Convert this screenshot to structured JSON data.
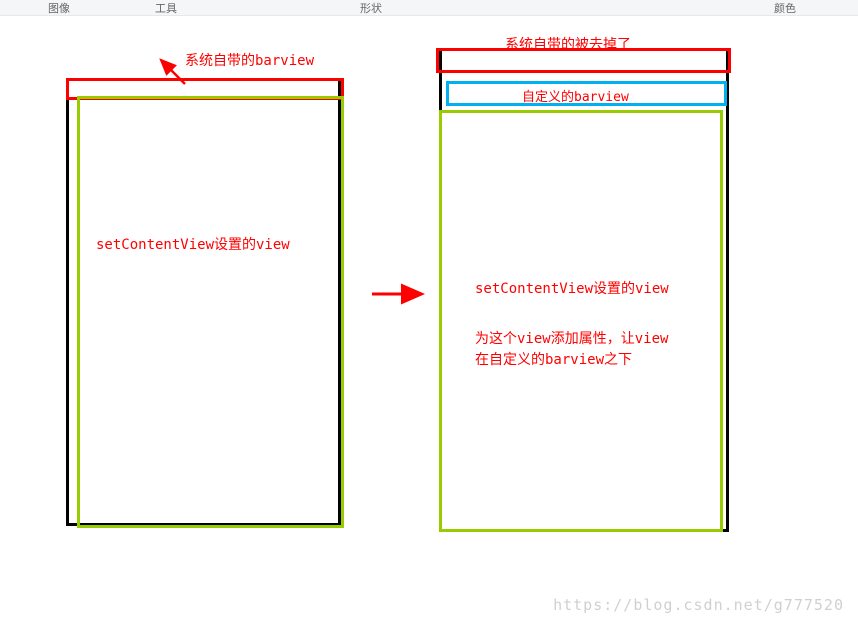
{
  "toolbar": {
    "image": "图像",
    "tool": "工具",
    "shape": "形状",
    "color": "颜色"
  },
  "labels": {
    "system_barview": "系统自带的barview",
    "left_content": "setContentView设置的view",
    "removed_bar": "系统自带的被去掉了",
    "custom_bar": "自定义的barview",
    "right_content": "setContentView设置的view",
    "below_desc": "为这个view添加属性，让view在自定义的barview之下"
  },
  "watermark": "https://blog.csdn.net/g777520"
}
